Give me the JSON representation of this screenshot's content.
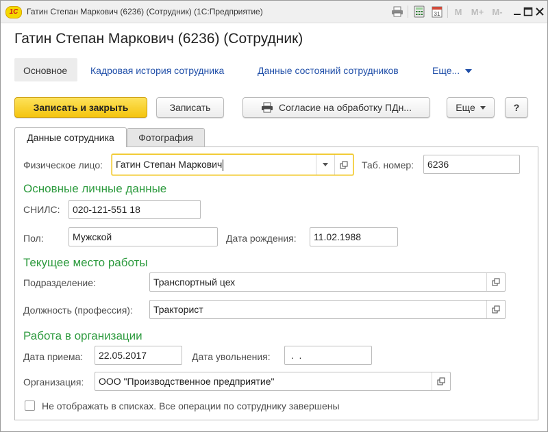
{
  "window": {
    "app_logo": "1С",
    "title": "Гатин Степан Маркович (6236) (Сотрудник)  (1С:Предприятие)",
    "m_buttons": [
      "M",
      "M+",
      "M-"
    ]
  },
  "form": {
    "title": "Гатин Степан Маркович (6236) (Сотрудник)"
  },
  "nav": {
    "items": [
      "Основное",
      "Кадровая история сотрудника",
      "Данные состояний сотрудников",
      "Еще..."
    ]
  },
  "toolbar": {
    "save_close": "Записать и закрыть",
    "save": "Записать",
    "consent": "Согласие на обработку ПДн...",
    "more": "Еще",
    "help": "?"
  },
  "tabs": [
    "Данные сотрудника",
    "Фотография"
  ],
  "fields": {
    "person_label": "Физическое лицо:",
    "person_value": "Гатин Степан Маркович",
    "tab_number_label": "Таб. номер:",
    "tab_number_value": "6236",
    "section_personal": "Основные личные данные",
    "snils_label": "СНИЛС:",
    "snils_value": "020-121-551 18",
    "gender_label": "Пол:",
    "gender_value": "Мужской",
    "birth_label": "Дата рождения:",
    "birth_value": "11.02.1988",
    "section_work": "Текущее место работы",
    "department_label": "Подразделение:",
    "department_value": "Транспортный цех",
    "position_label": "Должность (профессия):",
    "position_value": "Тракторист",
    "section_org": "Работа в организации",
    "hire_label": "Дата приема:",
    "hire_value": "22.05.2017",
    "dismissal_label": "Дата увольнения:",
    "dismissal_value": " .  .",
    "org_label": "Организация:",
    "org_value": "ООО \"Производственное предприятие\"",
    "hide_label": "Не отображать в списках. Все операции по сотруднику завершены",
    "hide_checked": false
  },
  "colors": {
    "primary_button": "#f4c40f",
    "section_header": "#2e9b3f",
    "link": "#1f4ea8",
    "focus_border": "#f0c419"
  }
}
